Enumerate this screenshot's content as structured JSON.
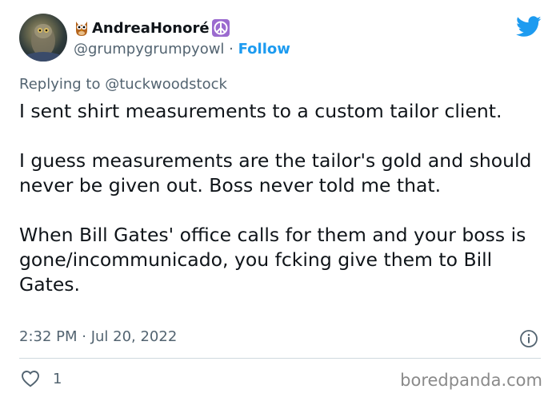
{
  "tweet": {
    "display_name": "AndreaHonoré",
    "handle": "@grumpygrumpyowl",
    "separator": " · ",
    "follow_label": "Follow",
    "reply_prefix": "Replying to ",
    "reply_to": "@tuckwoodstock",
    "paragraphs": [
      "I sent shirt measurements to a custom tailor client.",
      "I guess measurements are the tailor's gold and should never be given out. Boss never told me that.",
      "When Bill Gates' office calls for them and your boss is gone/incommunicado, you fcking give them to Bill Gates."
    ],
    "timestamp": "2:32 PM · Jul 20, 2022",
    "like_count": "1"
  },
  "icons": {
    "owl": "owl-emoji-icon",
    "peace": "peace-symbol-icon",
    "bird": "twitter-bird-icon",
    "info": "info-icon",
    "heart": "heart-outline-icon"
  },
  "colors": {
    "text": "#0f1419",
    "secondary": "#536471",
    "accent": "#1d9bf0",
    "peace_bg": "#9b6bcf",
    "divider": "#cfd9de"
  },
  "watermark": "boredpanda.com"
}
